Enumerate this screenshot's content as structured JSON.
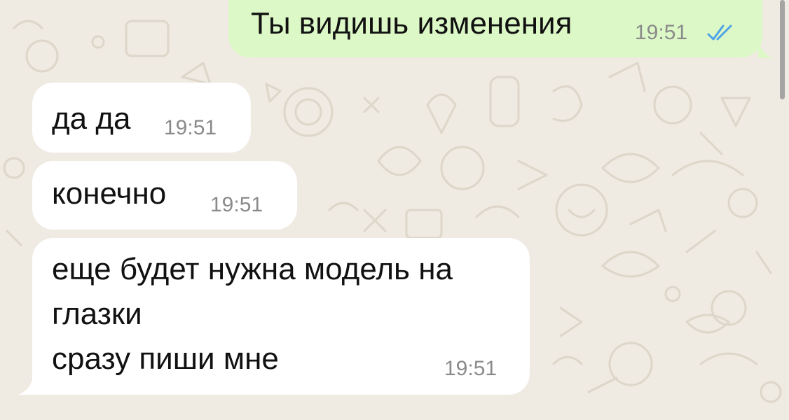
{
  "colors": {
    "background": "#efeae2",
    "incoming_bubble": "#ffffff",
    "outgoing_bubble": "#dcf8c6",
    "timestamp": "#8a8a8a",
    "read_ticks": "#4fa3e6"
  },
  "messages": [
    {
      "direction": "outgoing",
      "text": "Ты видишь изменения",
      "time": "19:51",
      "status_icon": "double-check-read-icon"
    },
    {
      "direction": "incoming",
      "text": "да да",
      "time": "19:51"
    },
    {
      "direction": "incoming",
      "text": "конечно",
      "time": "19:51"
    },
    {
      "direction": "incoming",
      "text": "еще будет нужна модель на\nглазки\nсразу пиши мне",
      "time": "19:51"
    }
  ]
}
